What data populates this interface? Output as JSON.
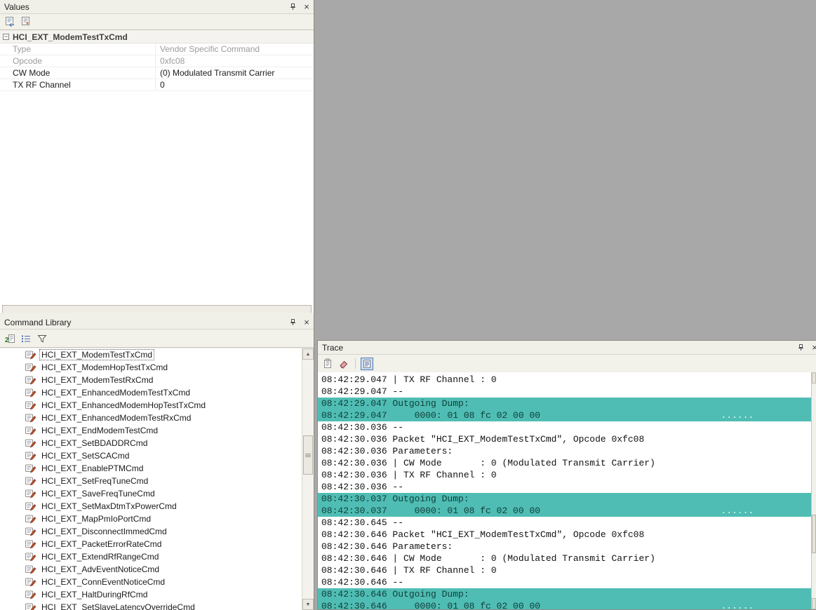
{
  "colors": {
    "workspace_background": "#a8a8a8",
    "trace_highlight": "#4fbdb4",
    "panel_chrome": "#f0efe8"
  },
  "values_panel": {
    "title": "Values",
    "toolbar_icons": [
      "apply-values-icon",
      "default-values-icon"
    ],
    "group_header": "HCI_EXT_ModemTestTxCmd",
    "rows": [
      {
        "label": "Type",
        "value": "Vendor Specific Command",
        "muted": true
      },
      {
        "label": "Opcode",
        "value": "0xfc08",
        "muted": true
      },
      {
        "label": "CW Mode",
        "value": "(0) Modulated Transmit Carrier",
        "muted": false
      },
      {
        "label": "TX RF Channel",
        "value": "0",
        "muted": false
      }
    ]
  },
  "command_library": {
    "title": "Command Library",
    "toolbar_icons": [
      "numbered-view-icon",
      "details-list-icon",
      "filter-icon"
    ],
    "selected_index": 0,
    "items": [
      "HCI_EXT_ModemTestTxCmd",
      "HCI_EXT_ModemHopTestTxCmd",
      "HCI_EXT_ModemTestRxCmd",
      "HCI_EXT_EnhancedModemTestTxCmd",
      "HCI_EXT_EnhancedModemHopTestTxCmd",
      "HCI_EXT_EnhancedModemTestRxCmd",
      "HCI_EXT_EndModemTestCmd",
      "HCI_EXT_SetBDADDRCmd",
      "HCI_EXT_SetSCACmd",
      "HCI_EXT_EnablePTMCmd",
      "HCI_EXT_SetFreqTuneCmd",
      "HCI_EXT_SaveFreqTuneCmd",
      "HCI_EXT_SetMaxDtmTxPowerCmd",
      "HCI_EXT_MapPmIoPortCmd",
      "HCI_EXT_DisconnectImmedCmd",
      "HCI_EXT_PacketErrorRateCmd",
      "HCI_EXT_ExtendRfRangeCmd",
      "HCI_EXT_AdvEventNoticeCmd",
      "HCI_EXT_ConnEventNoticeCmd",
      "HCI_EXT_HaltDuringRfCmd",
      "HCI_EXT_SetSlaveLatencyOverrideCmd"
    ]
  },
  "trace": {
    "title": "Trace",
    "toolbar_icons": [
      "clipboard-icon",
      "clear-trace-icon",
      "hex-dump-toggle-icon"
    ],
    "toggled_icon": "hex-dump-toggle-icon",
    "ascii_col": 73,
    "lines": [
      {
        "time": "08:42:29.047",
        "text": "| TX RF Channel : 0",
        "hl": false
      },
      {
        "time": "08:42:29.047",
        "text": "--",
        "hl": false
      },
      {
        "time": "08:42:29.047",
        "text": "Outgoing Dump:",
        "hl": true
      },
      {
        "time": "08:42:29.047",
        "text": "    0000: 01 08 fc 02 00 00",
        "ascii": "......",
        "hl": true
      },
      {
        "time": "08:42:30.036",
        "text": "--",
        "hl": false
      },
      {
        "time": "08:42:30.036",
        "text": "Packet \"HCI_EXT_ModemTestTxCmd\", Opcode 0xfc08",
        "hl": false
      },
      {
        "time": "08:42:30.036",
        "text": "Parameters:",
        "hl": false
      },
      {
        "time": "08:42:30.036",
        "text": "| CW Mode       : 0 (Modulated Transmit Carrier)",
        "hl": false
      },
      {
        "time": "08:42:30.036",
        "text": "| TX RF Channel : 0",
        "hl": false
      },
      {
        "time": "08:42:30.036",
        "text": "--",
        "hl": false
      },
      {
        "time": "08:42:30.037",
        "text": "Outgoing Dump:",
        "hl": true
      },
      {
        "time": "08:42:30.037",
        "text": "    0000: 01 08 fc 02 00 00",
        "ascii": "......",
        "hl": true
      },
      {
        "time": "08:42:30.645",
        "text": "--",
        "hl": false
      },
      {
        "time": "08:42:30.646",
        "text": "Packet \"HCI_EXT_ModemTestTxCmd\", Opcode 0xfc08",
        "hl": false
      },
      {
        "time": "08:42:30.646",
        "text": "Parameters:",
        "hl": false
      },
      {
        "time": "08:42:30.646",
        "text": "| CW Mode       : 0 (Modulated Transmit Carrier)",
        "hl": false
      },
      {
        "time": "08:42:30.646",
        "text": "| TX RF Channel : 0",
        "hl": false
      },
      {
        "time": "08:42:30.646",
        "text": "--",
        "hl": false
      },
      {
        "time": "08:42:30.646",
        "text": "Outgoing Dump:",
        "hl": true
      },
      {
        "time": "08:42:30.646",
        "text": "    0000: 01 08 fc 02 00 00",
        "ascii": "......",
        "hl": true
      }
    ]
  }
}
